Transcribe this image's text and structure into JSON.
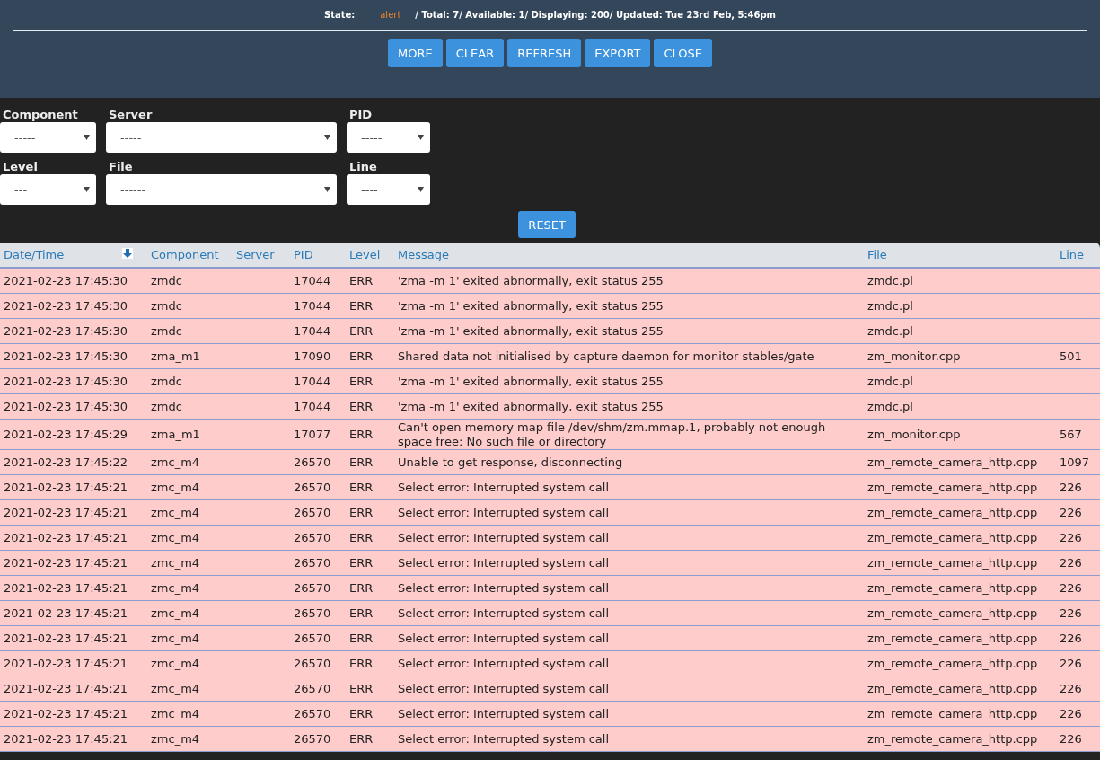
{
  "status": {
    "state_label": "State:",
    "state": "alert",
    "summary": "/ Total: 7/ Available: 1/ Displaying: 200/ Updated: Tue 23rd Feb, 5:46pm"
  },
  "buttons": [
    "MORE",
    "CLEAR",
    "REFRESH",
    "EXPORT",
    "CLOSE"
  ],
  "filters": [
    {
      "label": "Component",
      "value": "-----"
    },
    {
      "label": "Server",
      "value": "-----"
    },
    {
      "label": "PID",
      "value": "-----"
    },
    {
      "label": "Level",
      "value": "---"
    },
    {
      "label": "File",
      "value": "------"
    },
    {
      "label": "Line",
      "value": "----"
    }
  ],
  "reset_button": "RESET",
  "table": {
    "columns": [
      "Date/Time",
      "Component",
      "Server",
      "PID",
      "Level",
      "Message",
      "File",
      "Line"
    ],
    "rows": [
      {
        "datetime": "2021-02-23 17:45:30",
        "component": "zmdc",
        "pid": "17044",
        "level": "ERR",
        "message": "'zma -m 1' exited abnormally, exit status 255",
        "file": "zmdc.pl"
      },
      {
        "datetime": "2021-02-23 17:45:30",
        "component": "zmdc",
        "pid": "17044",
        "level": "ERR",
        "message": "'zma -m 1' exited abnormally, exit status 255",
        "file": "zmdc.pl"
      },
      {
        "datetime": "2021-02-23 17:45:30",
        "component": "zmdc",
        "pid": "17044",
        "level": "ERR",
        "message": "'zma -m 1' exited abnormally, exit status 255",
        "file": "zmdc.pl"
      },
      {
        "datetime": "2021-02-23 17:45:30",
        "component": "zma_m1",
        "pid": "17090",
        "level": "ERR",
        "message": "Shared data not initialised by capture daemon for monitor stables/gate",
        "file": "zm_monitor.cpp",
        "line": "501"
      },
      {
        "datetime": "2021-02-23 17:45:30",
        "component": "zmdc",
        "pid": "17044",
        "level": "ERR",
        "message": "'zma -m 1' exited abnormally, exit status 255",
        "file": "zmdc.pl"
      },
      {
        "datetime": "2021-02-23 17:45:30",
        "component": "zmdc",
        "pid": "17044",
        "level": "ERR",
        "message": "'zma -m 1' exited abnormally, exit status 255",
        "file": "zmdc.pl"
      },
      {
        "datetime": "2021-02-23 17:45:29",
        "component": "zma_m1",
        "pid": "17077",
        "level": "ERR",
        "message": "Can't open memory map file /dev/shm/zm.mmap.1, probably not enough space free: No such file or directory",
        "file": "zm_monitor.cpp",
        "line": "567"
      },
      {
        "datetime": "2021-02-23 17:45:22",
        "component": "zmc_m4",
        "pid": "26570",
        "level": "ERR",
        "message": "Unable to get response, disconnecting",
        "file": "zm_remote_camera_http.cpp",
        "line": "1097"
      },
      {
        "datetime": "2021-02-23 17:45:21",
        "component": "zmc_m4",
        "pid": "26570",
        "level": "ERR",
        "message": "Select error: Interrupted system call",
        "file": "zm_remote_camera_http.cpp",
        "line": "226"
      },
      {
        "datetime": "2021-02-23 17:45:21",
        "component": "zmc_m4",
        "pid": "26570",
        "level": "ERR",
        "message": "Select error: Interrupted system call",
        "file": "zm_remote_camera_http.cpp",
        "line": "226"
      },
      {
        "datetime": "2021-02-23 17:45:21",
        "component": "zmc_m4",
        "pid": "26570",
        "level": "ERR",
        "message": "Select error: Interrupted system call",
        "file": "zm_remote_camera_http.cpp",
        "line": "226"
      },
      {
        "datetime": "2021-02-23 17:45:21",
        "component": "zmc_m4",
        "pid": "26570",
        "level": "ERR",
        "message": "Select error: Interrupted system call",
        "file": "zm_remote_camera_http.cpp",
        "line": "226"
      },
      {
        "datetime": "2021-02-23 17:45:21",
        "component": "zmc_m4",
        "pid": "26570",
        "level": "ERR",
        "message": "Select error: Interrupted system call",
        "file": "zm_remote_camera_http.cpp",
        "line": "226"
      },
      {
        "datetime": "2021-02-23 17:45:21",
        "component": "zmc_m4",
        "pid": "26570",
        "level": "ERR",
        "message": "Select error: Interrupted system call",
        "file": "zm_remote_camera_http.cpp",
        "line": "226"
      },
      {
        "datetime": "2021-02-23 17:45:21",
        "component": "zmc_m4",
        "pid": "26570",
        "level": "ERR",
        "message": "Select error: Interrupted system call",
        "file": "zm_remote_camera_http.cpp",
        "line": "226"
      },
      {
        "datetime": "2021-02-23 17:45:21",
        "component": "zmc_m4",
        "pid": "26570",
        "level": "ERR",
        "message": "Select error: Interrupted system call",
        "file": "zm_remote_camera_http.cpp",
        "line": "226"
      },
      {
        "datetime": "2021-02-23 17:45:21",
        "component": "zmc_m4",
        "pid": "26570",
        "level": "ERR",
        "message": "Select error: Interrupted system call",
        "file": "zm_remote_camera_http.cpp",
        "line": "226"
      },
      {
        "datetime": "2021-02-23 17:45:21",
        "component": "zmc_m4",
        "pid": "26570",
        "level": "ERR",
        "message": "Select error: Interrupted system call",
        "file": "zm_remote_camera_http.cpp",
        "line": "226"
      },
      {
        "datetime": "2021-02-23 17:45:21",
        "component": "zmc_m4",
        "pid": "26570",
        "level": "ERR",
        "message": "Select error: Interrupted system call",
        "file": "zm_remote_camera_http.cpp",
        "line": "226"
      }
    ]
  }
}
